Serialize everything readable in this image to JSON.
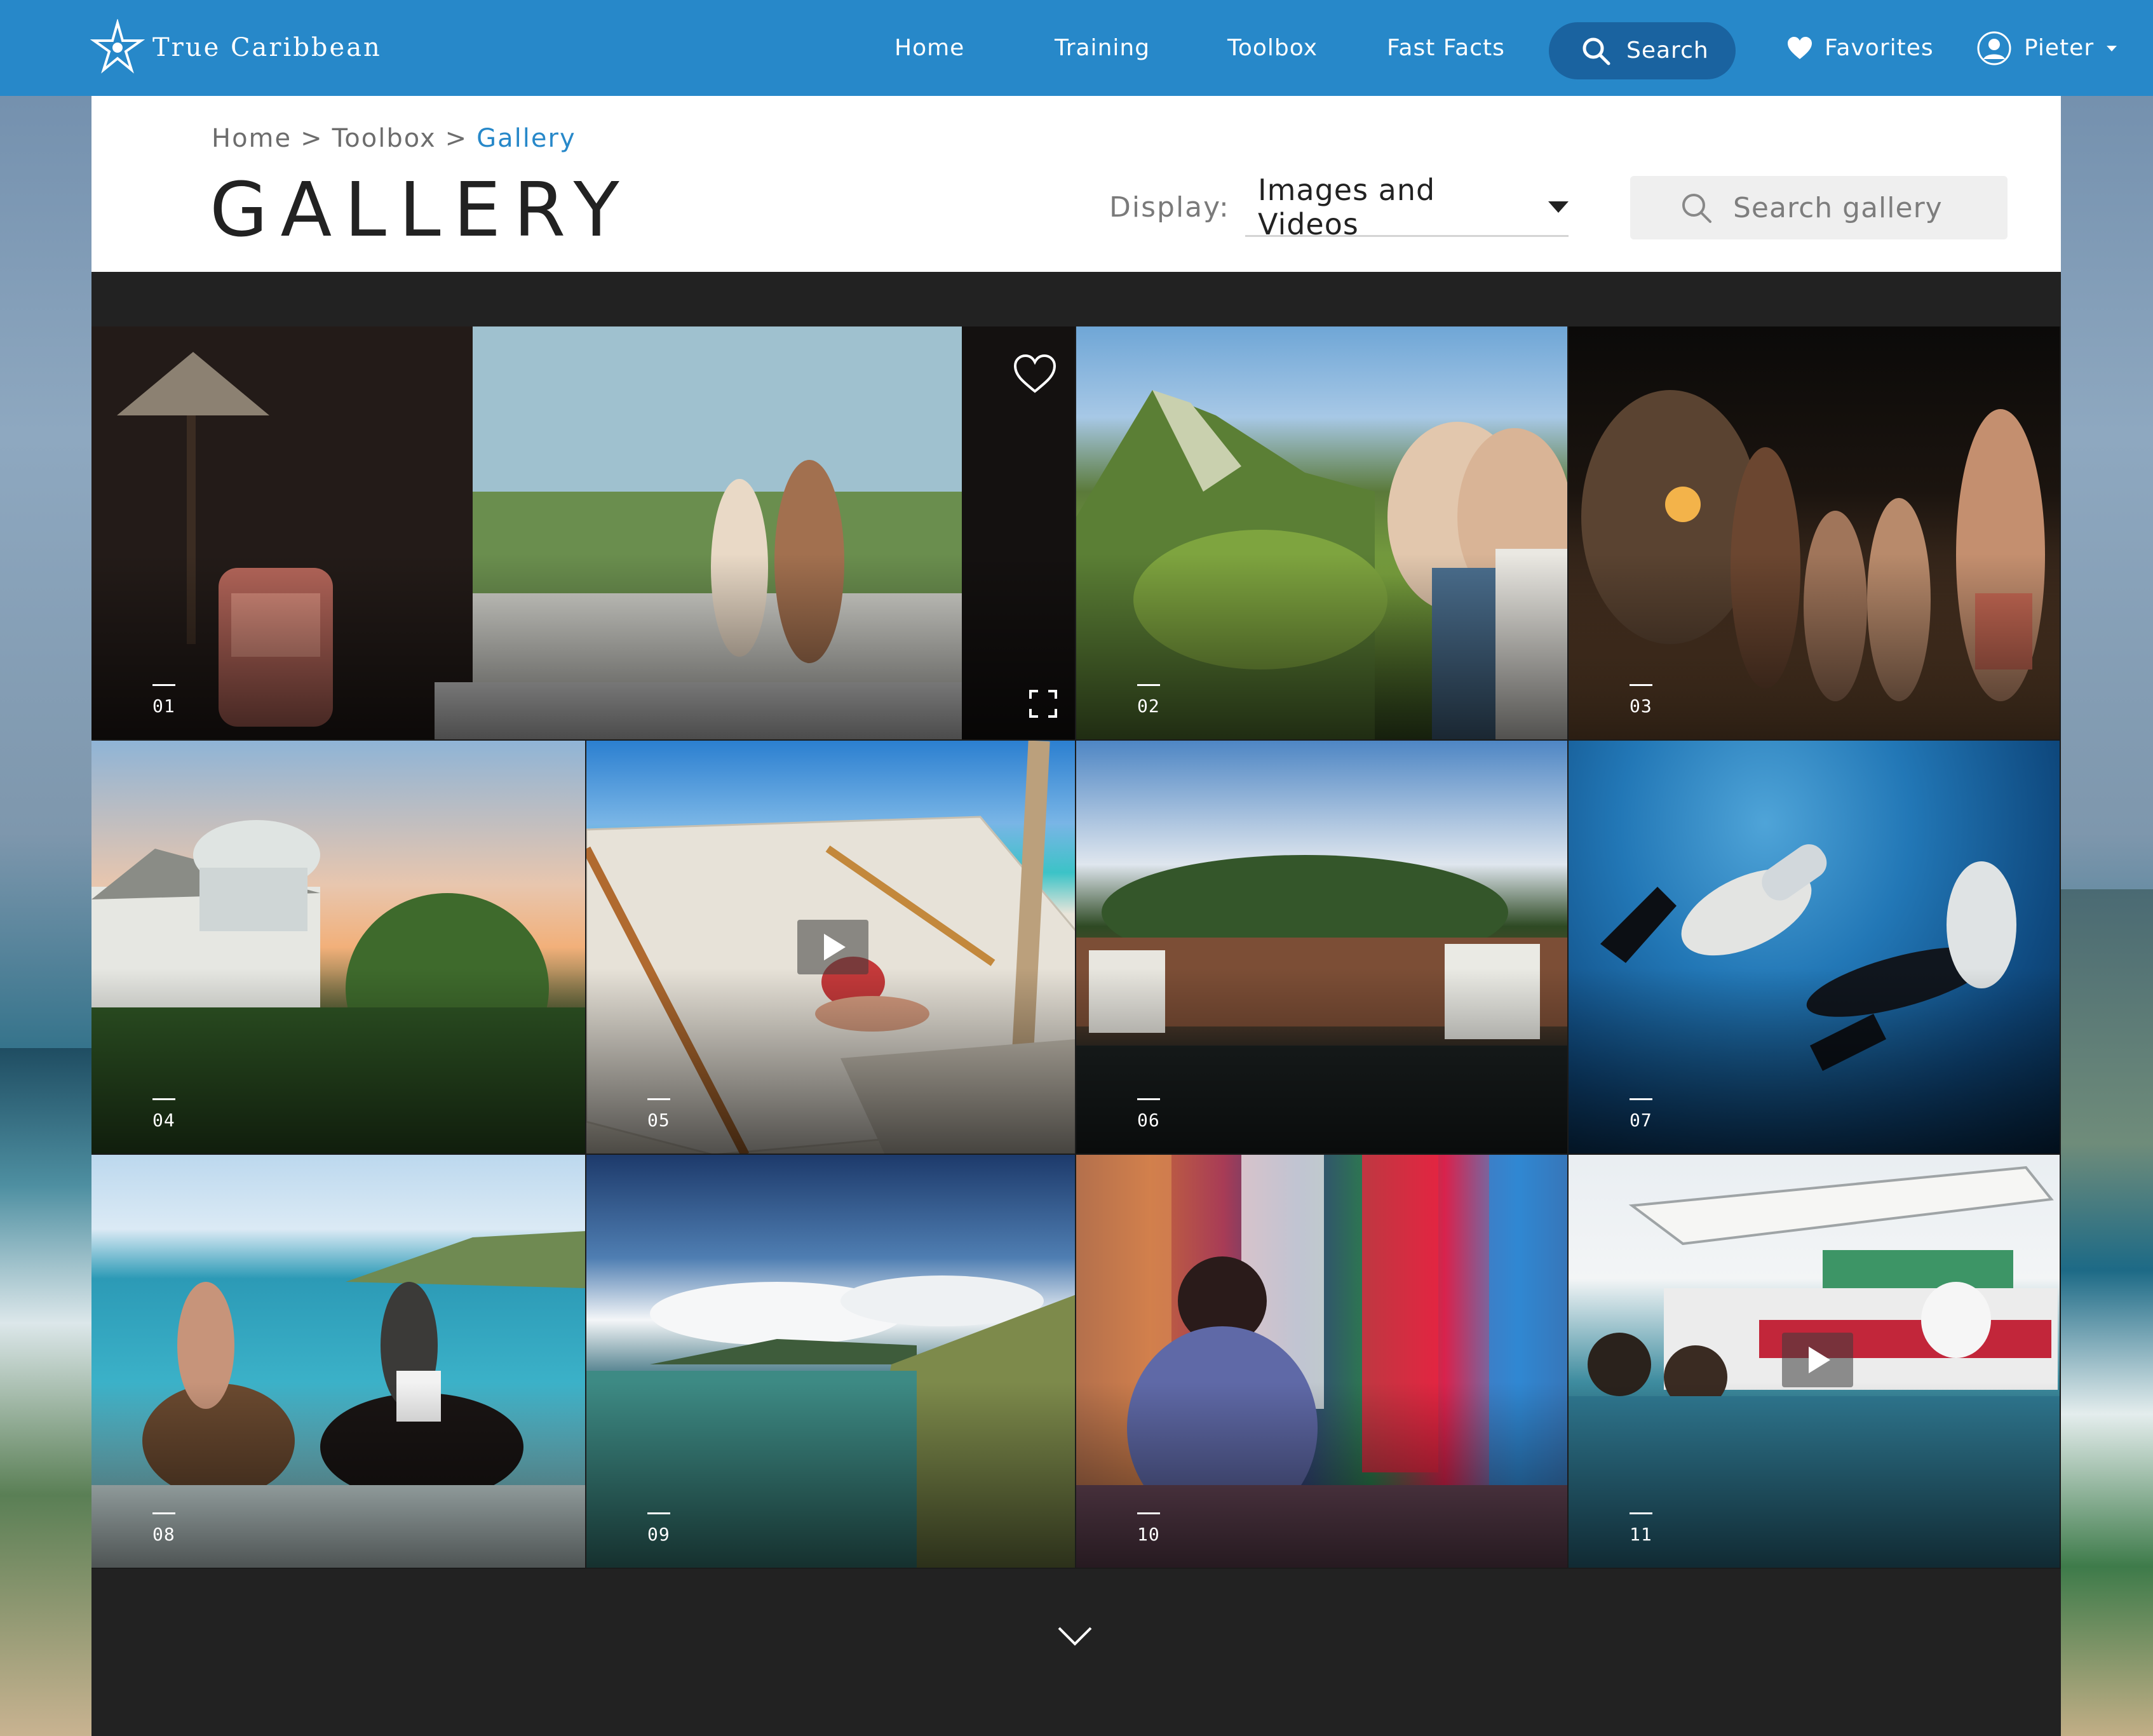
{
  "nav": {
    "brand": "True Caribbean",
    "home": "Home",
    "training": "Training",
    "toolbox": "Toolbox",
    "fast_facts": "Fast Facts",
    "search": "Search",
    "favorites": "Favorites",
    "user": "Pieter"
  },
  "breadcrumb": {
    "home": "Home",
    "toolbox": "Toolbox",
    "current": "Gallery",
    "separator": ">"
  },
  "page": {
    "title": "GALLERY",
    "display_label": "Display:",
    "display_value": "Images and Videos",
    "search_placeholder": "Search gallery"
  },
  "gallery": {
    "tiles": [
      {
        "num": "01",
        "scene": "resort-villa-couple",
        "type": "image"
      },
      {
        "num": "02",
        "scene": "mountain-crater-hikers",
        "type": "image"
      },
      {
        "num": "03",
        "scene": "night-beach-party",
        "type": "image"
      },
      {
        "num": "04",
        "scene": "hillside-house-sunset",
        "type": "image"
      },
      {
        "num": "05",
        "scene": "beach-hammock",
        "type": "video"
      },
      {
        "num": "06",
        "scene": "waterfall-river",
        "type": "image"
      },
      {
        "num": "07",
        "scene": "scuba-divers",
        "type": "image"
      },
      {
        "num": "08",
        "scene": "horseback-riding-surf",
        "type": "image"
      },
      {
        "num": "09",
        "scene": "coastline-aerial",
        "type": "image"
      },
      {
        "num": "10",
        "scene": "market-fabrics",
        "type": "image"
      },
      {
        "num": "11",
        "scene": "dive-boat-snorkelers",
        "type": "video"
      }
    ]
  },
  "colors": {
    "brand_blue": "#2788c9",
    "search_pill": "#1a63a0",
    "gallery_bg": "#222222",
    "breadcrumb_active": "#2788c9"
  },
  "icons": [
    "logo-star-icon",
    "search-icon",
    "heart-icon",
    "user-avatar-icon",
    "caret-down-icon",
    "play-icon",
    "expand-icon",
    "chevron-down-icon"
  ]
}
